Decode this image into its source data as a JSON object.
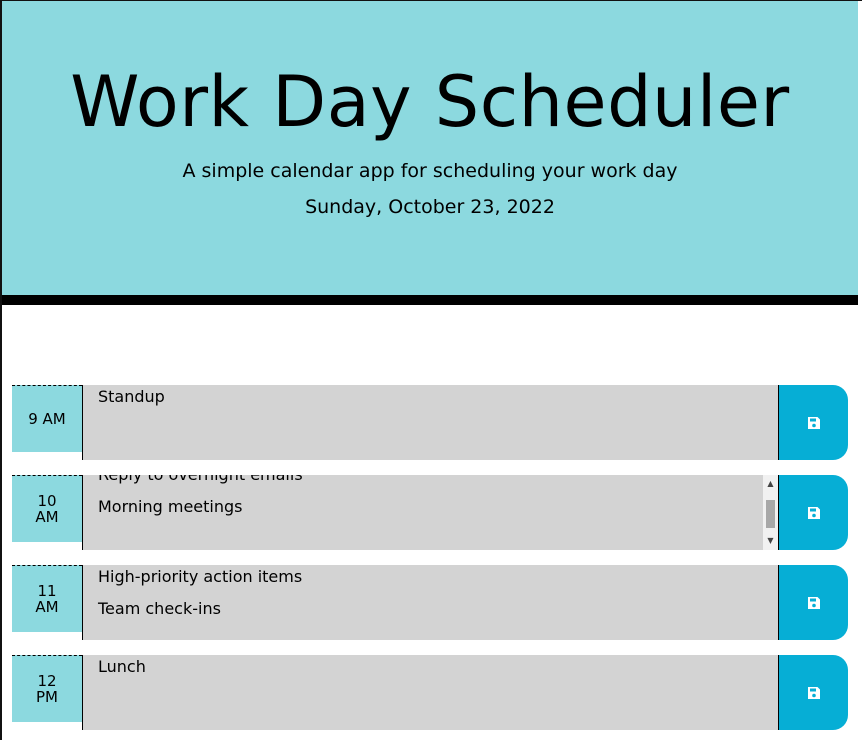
{
  "header": {
    "title": "Work Day Scheduler",
    "subtitle": "A simple calendar app for scheduling your work day",
    "current_day": "Sunday, October 23, 2022"
  },
  "time_blocks": [
    {
      "hour": "9 AM",
      "lines": [
        "Standup"
      ]
    },
    {
      "hour": "10 AM",
      "lines": [
        "Reply to overnight emails",
        "Morning meetings"
      ]
    },
    {
      "hour": "11 AM",
      "lines": [
        "High-priority action items",
        "Team check-ins"
      ]
    },
    {
      "hour": "12 PM",
      "lines": [
        "Lunch"
      ]
    }
  ],
  "icons": {
    "save": "floppy-disk-icon"
  },
  "colors": {
    "header_bg": "#8cd9df",
    "save_button": "#06aed5",
    "textarea_bg": "#d3d3d3"
  }
}
